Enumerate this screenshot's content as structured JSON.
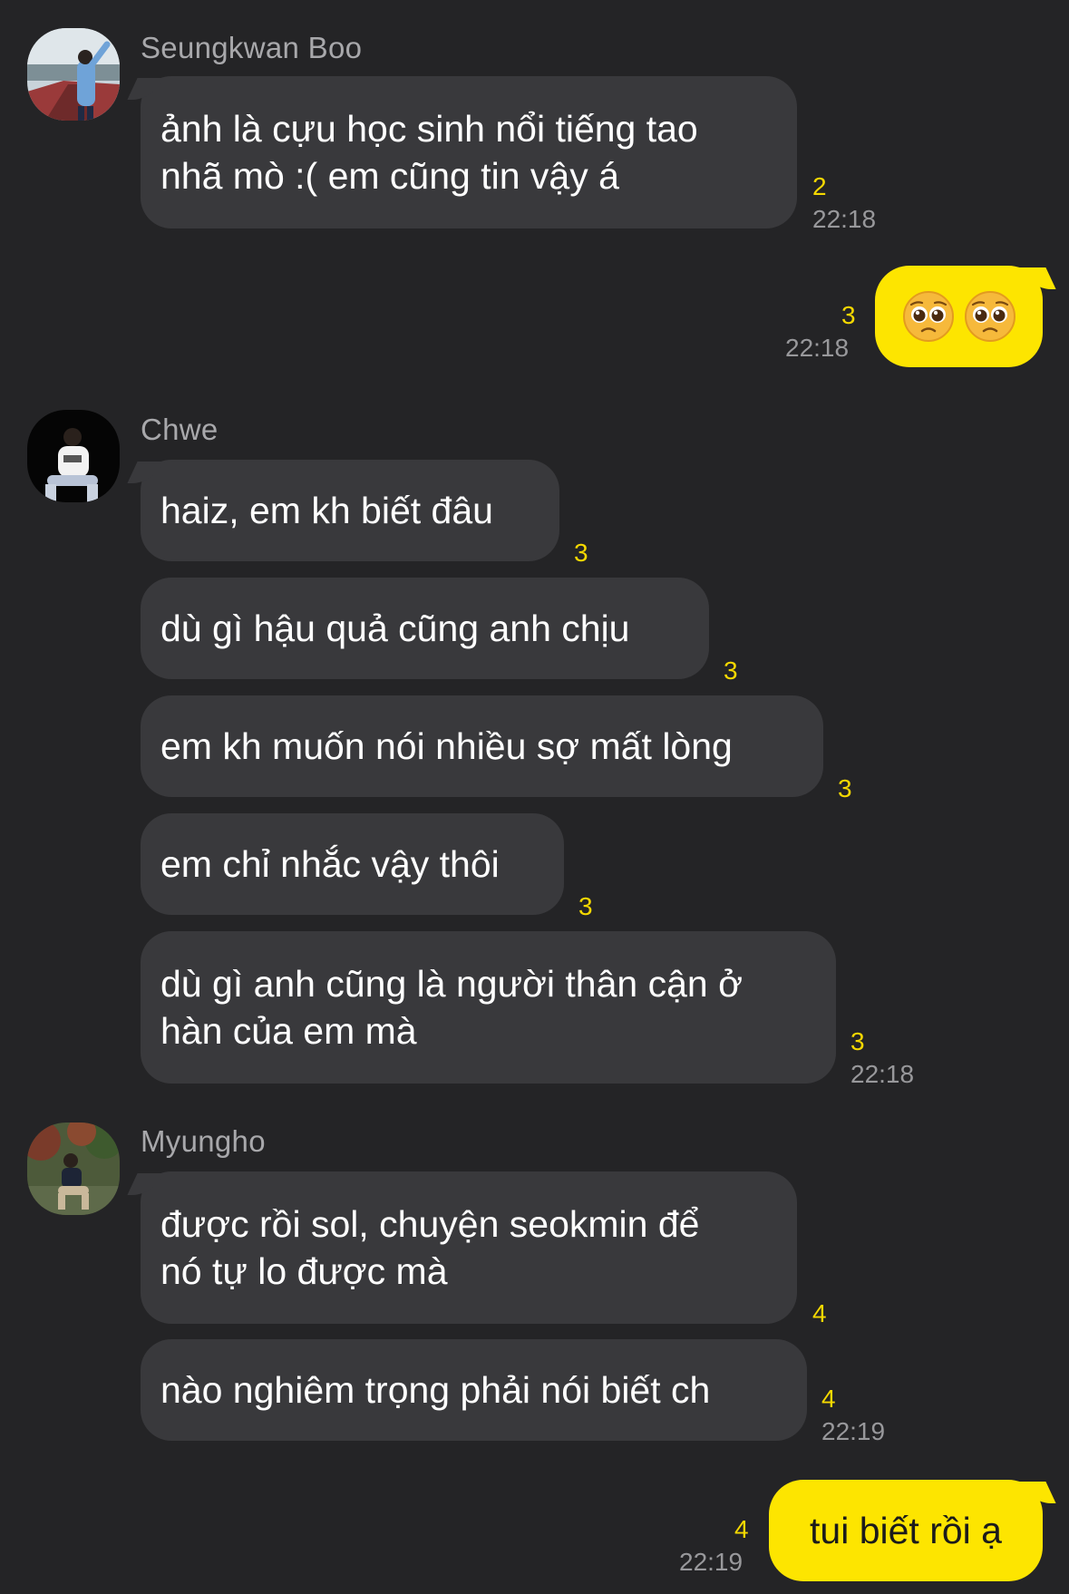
{
  "groups": [
    {
      "sender": "Seungkwan Boo",
      "messages": [
        {
          "lines": [
            "ảnh là cựu học sinh nổi tiếng tao",
            "nhã mò :( em cũng tin vậy á"
          ],
          "unread": "2",
          "time": "22:18"
        }
      ]
    },
    {
      "mine": true,
      "messages": [
        {
          "emoji": [
            "pleading-face",
            "pleading-face"
          ],
          "unread": "3",
          "time": "22:18"
        }
      ]
    },
    {
      "sender": "Chwe",
      "messages": [
        {
          "lines": [
            "haiz, em kh biết đâu"
          ],
          "unread": "3"
        },
        {
          "lines": [
            "dù gì hậu quả cũng anh chịu"
          ],
          "unread": "3"
        },
        {
          "lines": [
            "em kh muốn nói nhiều sợ mất lòng"
          ],
          "unread": "3"
        },
        {
          "lines": [
            "em chỉ nhắc vậy thôi"
          ],
          "unread": "3"
        },
        {
          "lines": [
            "dù gì anh cũng là người thân cận ở",
            "hàn của em mà"
          ],
          "unread": "3",
          "time": "22:18"
        }
      ]
    },
    {
      "sender": "Myungho",
      "messages": [
        {
          "lines": [
            "được rồi sol, chuyện seokmin để",
            "nó tự lo được mà"
          ],
          "unread": "4"
        },
        {
          "lines": [
            "nào nghiêm trọng phải nói biết ch"
          ],
          "unread": "4",
          "time": "22:19"
        }
      ]
    },
    {
      "mine": true,
      "messages": [
        {
          "lines": [
            "tui biết rồi ạ"
          ],
          "unread": "4",
          "time": "22:19"
        }
      ]
    }
  ],
  "colors": {
    "background": "#242426",
    "incoming_bubble": "#39393c",
    "outgoing_bubble": "#fde500",
    "unread_count": "#f5d800",
    "timestamp": "#98989b",
    "sender_name": "#a8a8ab"
  }
}
